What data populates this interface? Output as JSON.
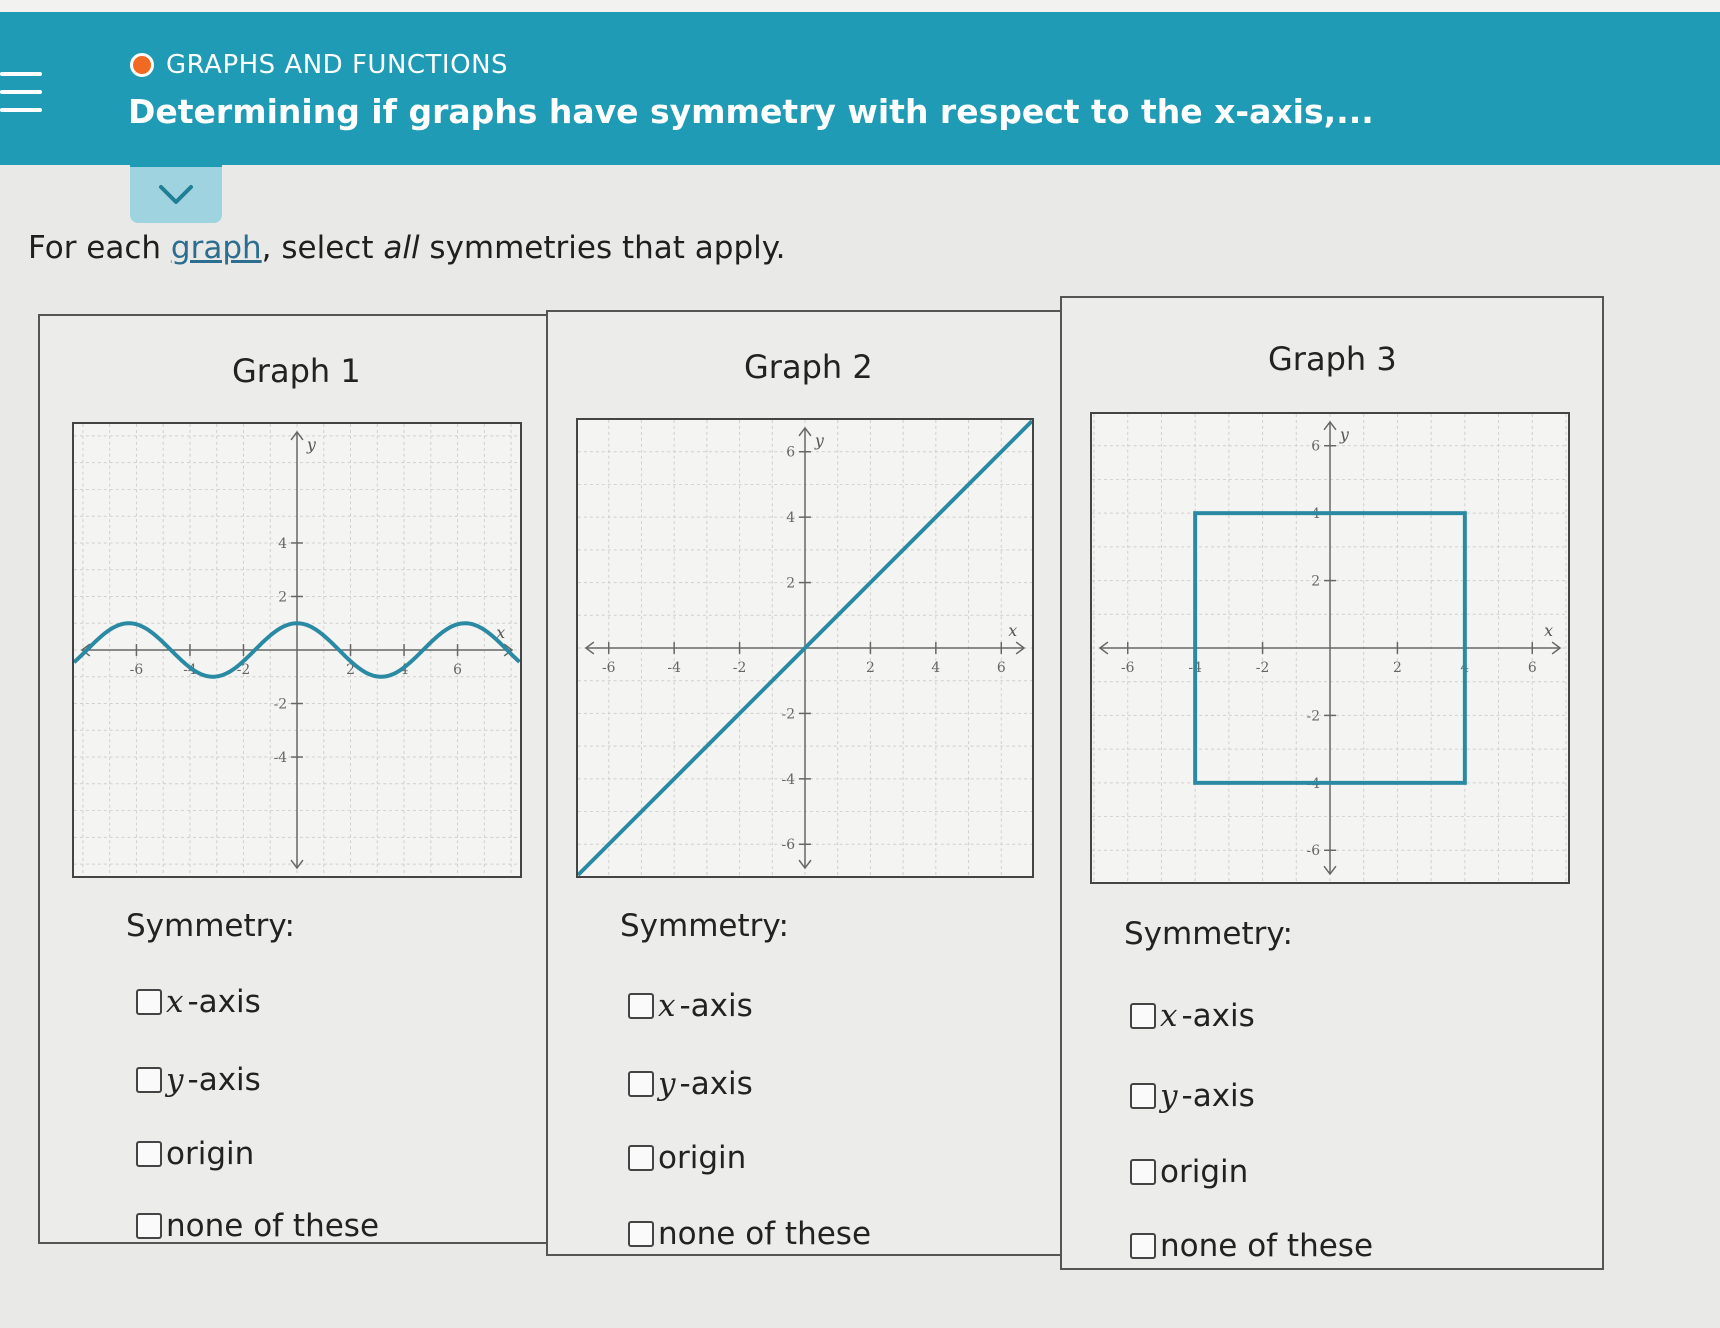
{
  "header": {
    "topic": "GRAPHS AND FUNCTIONS",
    "title": "Determining if graphs have symmetry with respect to the x-axis,..."
  },
  "instruction": {
    "before": "For each ",
    "link": "graph",
    "middle": ", select ",
    "emph": "all",
    "after": " symmetries that apply."
  },
  "symmetry_label": "Symmetry:",
  "options": [
    {
      "var": "x",
      "rest": "-axis"
    },
    {
      "var": "y",
      "rest": "-axis"
    },
    {
      "var": "",
      "rest": "origin"
    },
    {
      "var": "",
      "rest": "none of these"
    }
  ],
  "axis_labels": {
    "x": "x",
    "y": "y"
  },
  "graphs": [
    {
      "title": "Graph 1",
      "x_ticks": [
        "-6",
        "-4",
        "-2",
        "2",
        "4",
        "6"
      ],
      "y_ticks": [
        "4",
        "2",
        "-2",
        "-4"
      ],
      "curve": "y = cos(x)"
    },
    {
      "title": "Graph 2",
      "x_ticks": [
        "-6",
        "-4",
        "-2",
        "2",
        "4",
        "6"
      ],
      "y_ticks": [
        "6",
        "4",
        "2",
        "-2",
        "-4",
        "-6"
      ],
      "curve": "y = x"
    },
    {
      "title": "Graph 3",
      "x_ticks": [
        "-6",
        "-4",
        "-2",
        "2",
        "4",
        "6"
      ],
      "y_ticks": [
        "6",
        "4",
        "2",
        "-2",
        "-4",
        "-6"
      ],
      "curve": "square from (-4,-4) to (4,4)"
    }
  ],
  "colors": {
    "header": "#1f9bb5",
    "accent_dot": "#f26a21",
    "curve": "#2a8aa3"
  }
}
